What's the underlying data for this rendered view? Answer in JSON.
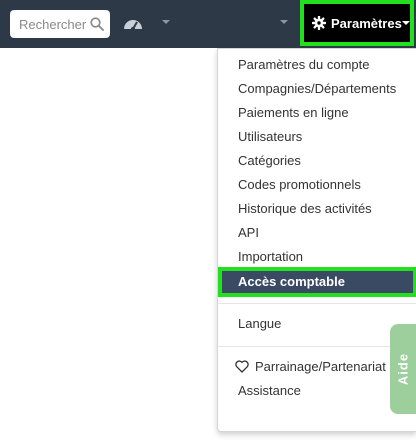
{
  "topbar": {
    "search_placeholder": "Rechercher",
    "settings_label": "Paramètres"
  },
  "menu": {
    "items": [
      "Paramètres du compte",
      "Compagnies/Départements",
      "Paiements en ligne",
      "Utilisateurs",
      "Catégories",
      "Codes promotionnels",
      "Historique des activités",
      "API",
      "Importation"
    ],
    "active_item": "Accès comptable",
    "language": "Langue",
    "referral": "Parrainage/Partenariat",
    "support": "Assistance"
  },
  "help_tab": "Aide",
  "colors": {
    "topbar": "#2e3947",
    "highlight": "#22e01e",
    "active_bg": "#3b4a63",
    "help_tab": "#9ccf9b"
  }
}
